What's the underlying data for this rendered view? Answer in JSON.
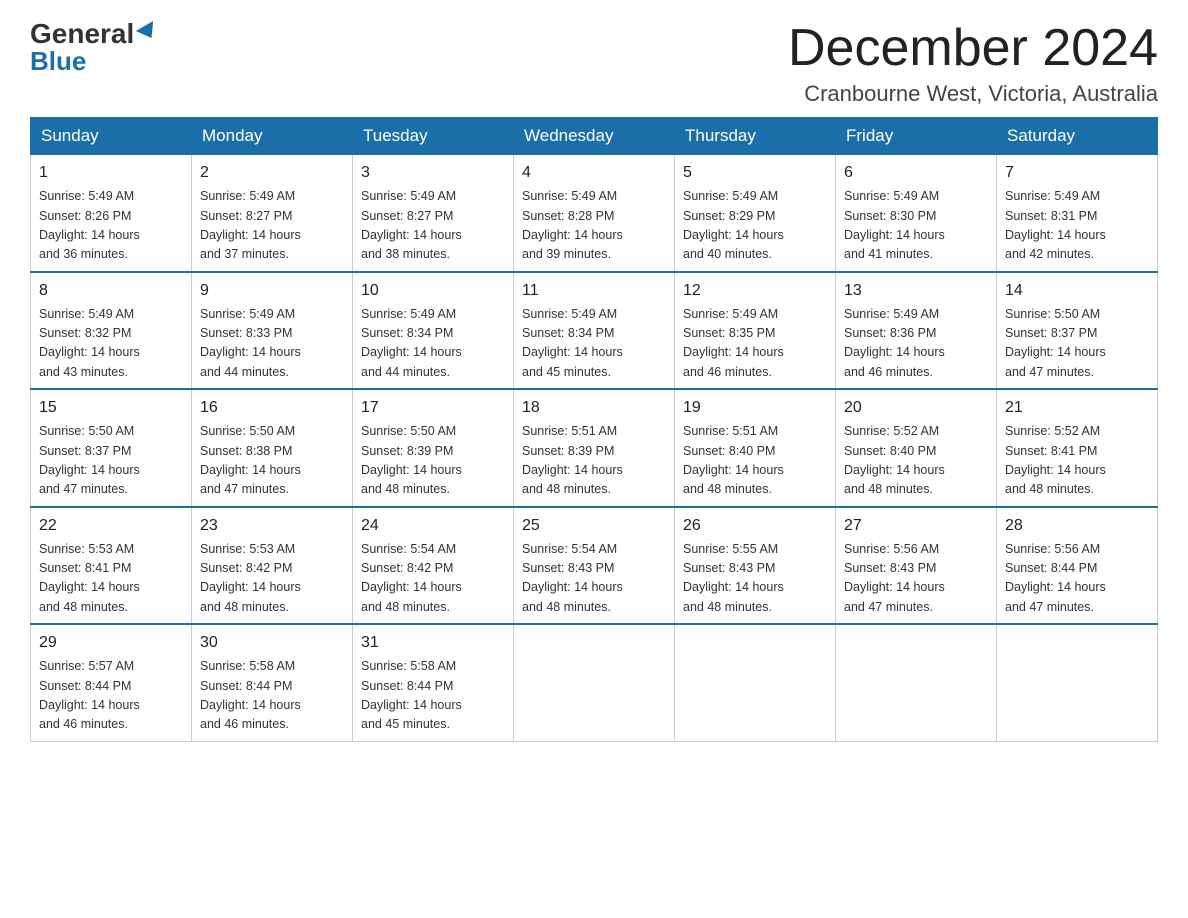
{
  "header": {
    "logo_general": "General",
    "logo_blue": "Blue",
    "month_year": "December 2024",
    "location": "Cranbourne West, Victoria, Australia"
  },
  "columns": [
    "Sunday",
    "Monday",
    "Tuesday",
    "Wednesday",
    "Thursday",
    "Friday",
    "Saturday"
  ],
  "weeks": [
    [
      {
        "day": "1",
        "sunrise": "5:49 AM",
        "sunset": "8:26 PM",
        "daylight": "14 hours and 36 minutes."
      },
      {
        "day": "2",
        "sunrise": "5:49 AM",
        "sunset": "8:27 PM",
        "daylight": "14 hours and 37 minutes."
      },
      {
        "day": "3",
        "sunrise": "5:49 AM",
        "sunset": "8:27 PM",
        "daylight": "14 hours and 38 minutes."
      },
      {
        "day": "4",
        "sunrise": "5:49 AM",
        "sunset": "8:28 PM",
        "daylight": "14 hours and 39 minutes."
      },
      {
        "day": "5",
        "sunrise": "5:49 AM",
        "sunset": "8:29 PM",
        "daylight": "14 hours and 40 minutes."
      },
      {
        "day": "6",
        "sunrise": "5:49 AM",
        "sunset": "8:30 PM",
        "daylight": "14 hours and 41 minutes."
      },
      {
        "day": "7",
        "sunrise": "5:49 AM",
        "sunset": "8:31 PM",
        "daylight": "14 hours and 42 minutes."
      }
    ],
    [
      {
        "day": "8",
        "sunrise": "5:49 AM",
        "sunset": "8:32 PM",
        "daylight": "14 hours and 43 minutes."
      },
      {
        "day": "9",
        "sunrise": "5:49 AM",
        "sunset": "8:33 PM",
        "daylight": "14 hours and 44 minutes."
      },
      {
        "day": "10",
        "sunrise": "5:49 AM",
        "sunset": "8:34 PM",
        "daylight": "14 hours and 44 minutes."
      },
      {
        "day": "11",
        "sunrise": "5:49 AM",
        "sunset": "8:34 PM",
        "daylight": "14 hours and 45 minutes."
      },
      {
        "day": "12",
        "sunrise": "5:49 AM",
        "sunset": "8:35 PM",
        "daylight": "14 hours and 46 minutes."
      },
      {
        "day": "13",
        "sunrise": "5:49 AM",
        "sunset": "8:36 PM",
        "daylight": "14 hours and 46 minutes."
      },
      {
        "day": "14",
        "sunrise": "5:50 AM",
        "sunset": "8:37 PM",
        "daylight": "14 hours and 47 minutes."
      }
    ],
    [
      {
        "day": "15",
        "sunrise": "5:50 AM",
        "sunset": "8:37 PM",
        "daylight": "14 hours and 47 minutes."
      },
      {
        "day": "16",
        "sunrise": "5:50 AM",
        "sunset": "8:38 PM",
        "daylight": "14 hours and 47 minutes."
      },
      {
        "day": "17",
        "sunrise": "5:50 AM",
        "sunset": "8:39 PM",
        "daylight": "14 hours and 48 minutes."
      },
      {
        "day": "18",
        "sunrise": "5:51 AM",
        "sunset": "8:39 PM",
        "daylight": "14 hours and 48 minutes."
      },
      {
        "day": "19",
        "sunrise": "5:51 AM",
        "sunset": "8:40 PM",
        "daylight": "14 hours and 48 minutes."
      },
      {
        "day": "20",
        "sunrise": "5:52 AM",
        "sunset": "8:40 PM",
        "daylight": "14 hours and 48 minutes."
      },
      {
        "day": "21",
        "sunrise": "5:52 AM",
        "sunset": "8:41 PM",
        "daylight": "14 hours and 48 minutes."
      }
    ],
    [
      {
        "day": "22",
        "sunrise": "5:53 AM",
        "sunset": "8:41 PM",
        "daylight": "14 hours and 48 minutes."
      },
      {
        "day": "23",
        "sunrise": "5:53 AM",
        "sunset": "8:42 PM",
        "daylight": "14 hours and 48 minutes."
      },
      {
        "day": "24",
        "sunrise": "5:54 AM",
        "sunset": "8:42 PM",
        "daylight": "14 hours and 48 minutes."
      },
      {
        "day": "25",
        "sunrise": "5:54 AM",
        "sunset": "8:43 PM",
        "daylight": "14 hours and 48 minutes."
      },
      {
        "day": "26",
        "sunrise": "5:55 AM",
        "sunset": "8:43 PM",
        "daylight": "14 hours and 48 minutes."
      },
      {
        "day": "27",
        "sunrise": "5:56 AM",
        "sunset": "8:43 PM",
        "daylight": "14 hours and 47 minutes."
      },
      {
        "day": "28",
        "sunrise": "5:56 AM",
        "sunset": "8:44 PM",
        "daylight": "14 hours and 47 minutes."
      }
    ],
    [
      {
        "day": "29",
        "sunrise": "5:57 AM",
        "sunset": "8:44 PM",
        "daylight": "14 hours and 46 minutes."
      },
      {
        "day": "30",
        "sunrise": "5:58 AM",
        "sunset": "8:44 PM",
        "daylight": "14 hours and 46 minutes."
      },
      {
        "day": "31",
        "sunrise": "5:58 AM",
        "sunset": "8:44 PM",
        "daylight": "14 hours and 45 minutes."
      },
      null,
      null,
      null,
      null
    ]
  ],
  "labels": {
    "sunrise_prefix": "Sunrise: ",
    "sunset_prefix": "Sunset: ",
    "daylight_prefix": "Daylight: "
  }
}
